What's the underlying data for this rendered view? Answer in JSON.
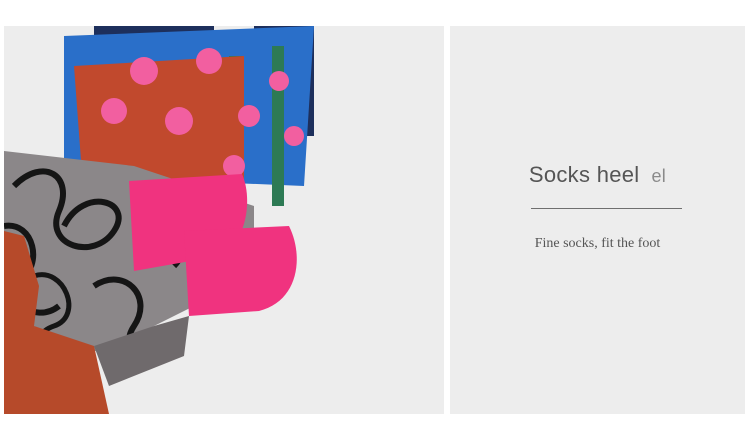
{
  "product_image": {
    "subject": "sock-heel-closeup"
  },
  "info_panel": {
    "title": "Socks heel",
    "title_overflow": "el",
    "subtitle": "Fine socks, fit the foot"
  }
}
